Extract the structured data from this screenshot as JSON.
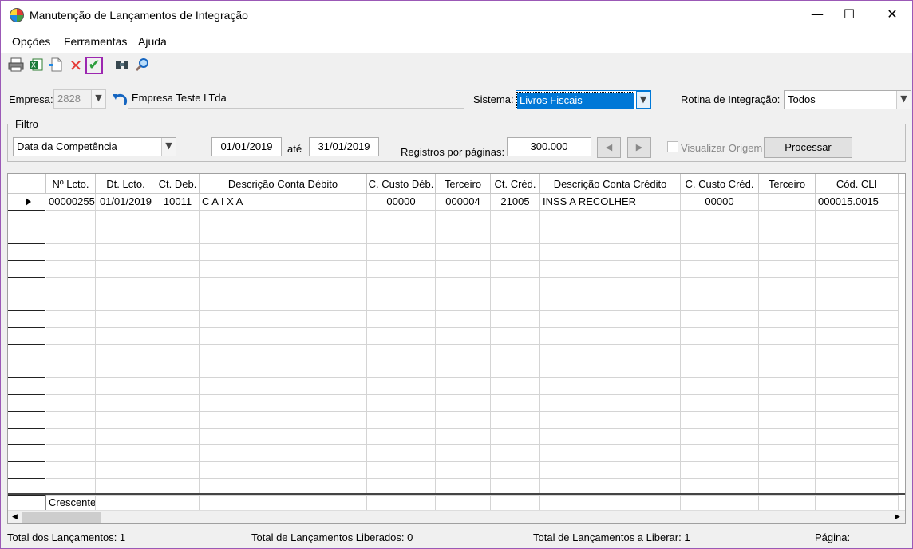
{
  "window": {
    "title": "Manutenção de Lançamentos de Integração",
    "minimize": "—",
    "maximize": "☐",
    "close": "✕"
  },
  "menu": [
    {
      "label": "Opções"
    },
    {
      "label": "Ferramentas"
    },
    {
      "label": "Ajuda"
    }
  ],
  "toolbar": {
    "icons": [
      "printer-icon",
      "excel-export-icon",
      "new-document-icon",
      "delete-icon",
      "confirm-icon",
      "binoculars-icon",
      "magnifier-icon"
    ],
    "selected": "confirm-icon"
  },
  "empresa": {
    "label": "Empresa:",
    "code": "2828",
    "name": "Empresa Teste LTda"
  },
  "sistema": {
    "label": "Sistema:",
    "value": "Livros Fiscais"
  },
  "rotina": {
    "label": "Rotina de Integração:",
    "value": "Todos"
  },
  "filtro": {
    "title": "Filtro",
    "tipo": "Data da Competência",
    "date_from": "01/01/2019",
    "ate": "até",
    "date_to": "31/01/2019",
    "registros_label": "Registros por páginas:",
    "registros_value": "300.000",
    "visualizar_label": "Visualizar Origem",
    "processar": "Processar"
  },
  "grid": {
    "columns": [
      "Nº Lcto.",
      "Dt. Lcto.",
      "Ct. Deb.",
      "Descrição Conta Débito",
      "C. Custo Déb.",
      "Terceiro",
      "Ct. Créd.",
      "Descrição Conta Crédito",
      "C. Custo Créd.",
      "Terceiro",
      "Cód. CLI"
    ],
    "rows": [
      [
        "00000255",
        "01/01/2019",
        "10011",
        "C A I X A",
        "00000",
        "000004",
        "21005",
        "INSS A RECOLHER",
        "00000",
        "",
        "000015.0015"
      ]
    ],
    "footer": "Crescente"
  },
  "status": {
    "total": "Total dos Lançamentos: 1",
    "liberados": "Total de Lançamentos Liberados: 0",
    "a_liberar": "Total de Lançamentos a Liberar: 1",
    "pagina": "Página:"
  },
  "colors": {
    "selection": "#0078d7",
    "highlight_border": "#9c27b0"
  }
}
